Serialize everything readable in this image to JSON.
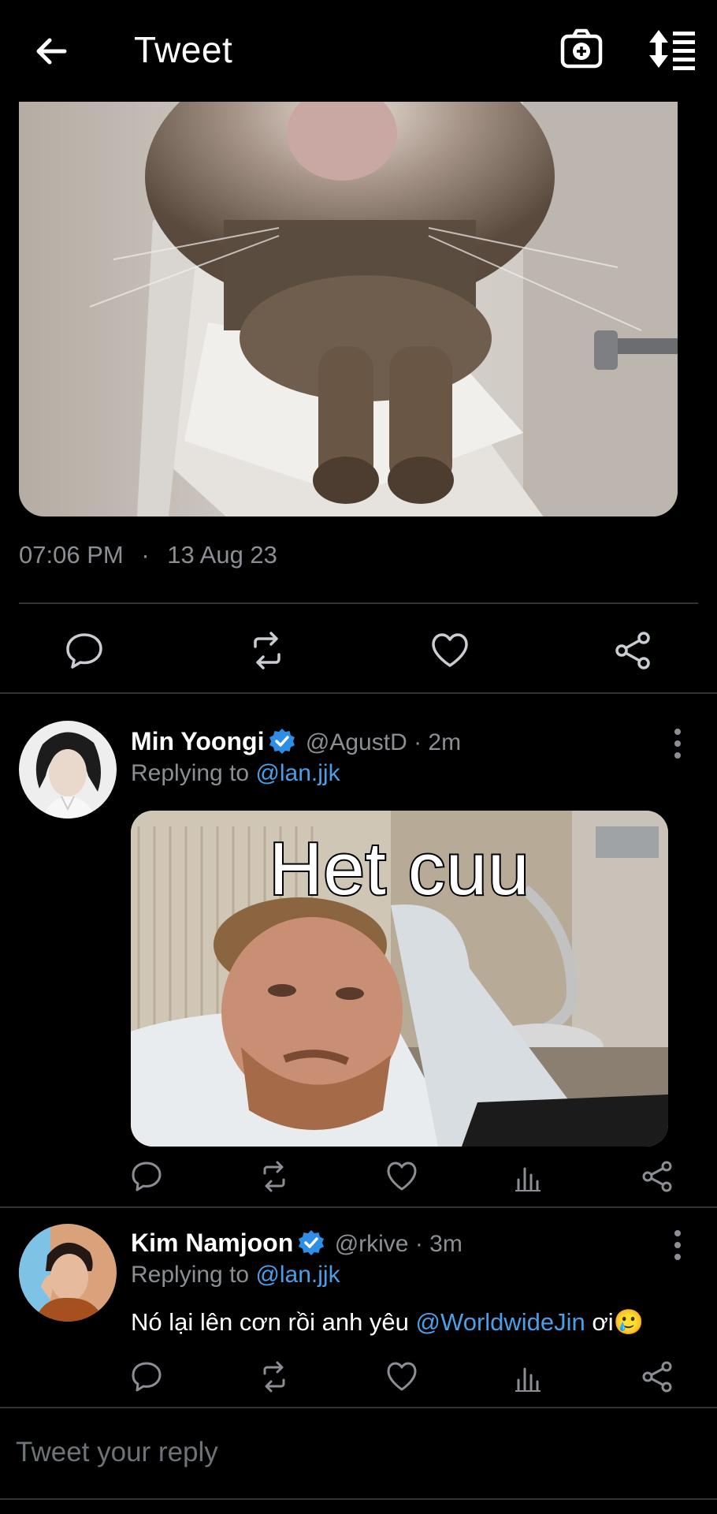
{
  "header": {
    "title": "Tweet"
  },
  "main_tweet": {
    "time": "07:06 PM",
    "separator": "·",
    "date": "13 Aug 23"
  },
  "replies": [
    {
      "name": "Min Yoongi",
      "handle": "@AgustD · 2m",
      "replying_prefix": "Replying to",
      "replying_to": "@lan.jjk",
      "image_caption": "Het cuu"
    },
    {
      "name": "Kim Namjoon",
      "handle": "@rkive · 3m",
      "replying_prefix": "Replying to",
      "replying_to": "@lan.jjk",
      "text_before": "Nó lại lên cơn rồi anh yêu",
      "mention": "@WorldwideJin",
      "text_after": "ơi🥲"
    }
  ],
  "composer": {
    "placeholder": "Tweet your reply"
  },
  "colors": {
    "background": "#000000",
    "link": "#4a9fe8",
    "muted": "#8b8f94",
    "divider": "#2f3336"
  }
}
